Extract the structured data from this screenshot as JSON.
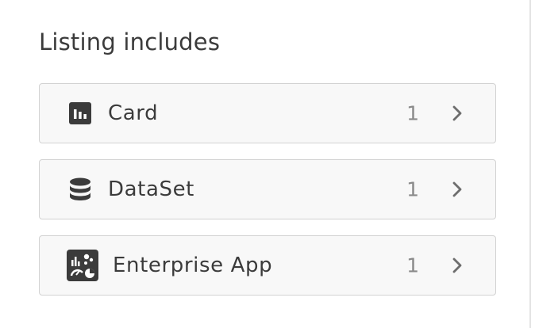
{
  "section": {
    "title": "Listing includes"
  },
  "items": [
    {
      "label": "Card",
      "count": "1",
      "icon": "bar-chart-icon"
    },
    {
      "label": "DataSet",
      "count": "1",
      "icon": "database-icon"
    },
    {
      "label": "Enterprise App",
      "count": "1",
      "icon": "enterprise-app-icon"
    }
  ],
  "colors": {
    "text": "#3b3b3b",
    "count": "#8a8a8a",
    "row_background": "#f8f8f8",
    "row_border": "#d2d2d2",
    "icon": "#3b3b3b"
  }
}
